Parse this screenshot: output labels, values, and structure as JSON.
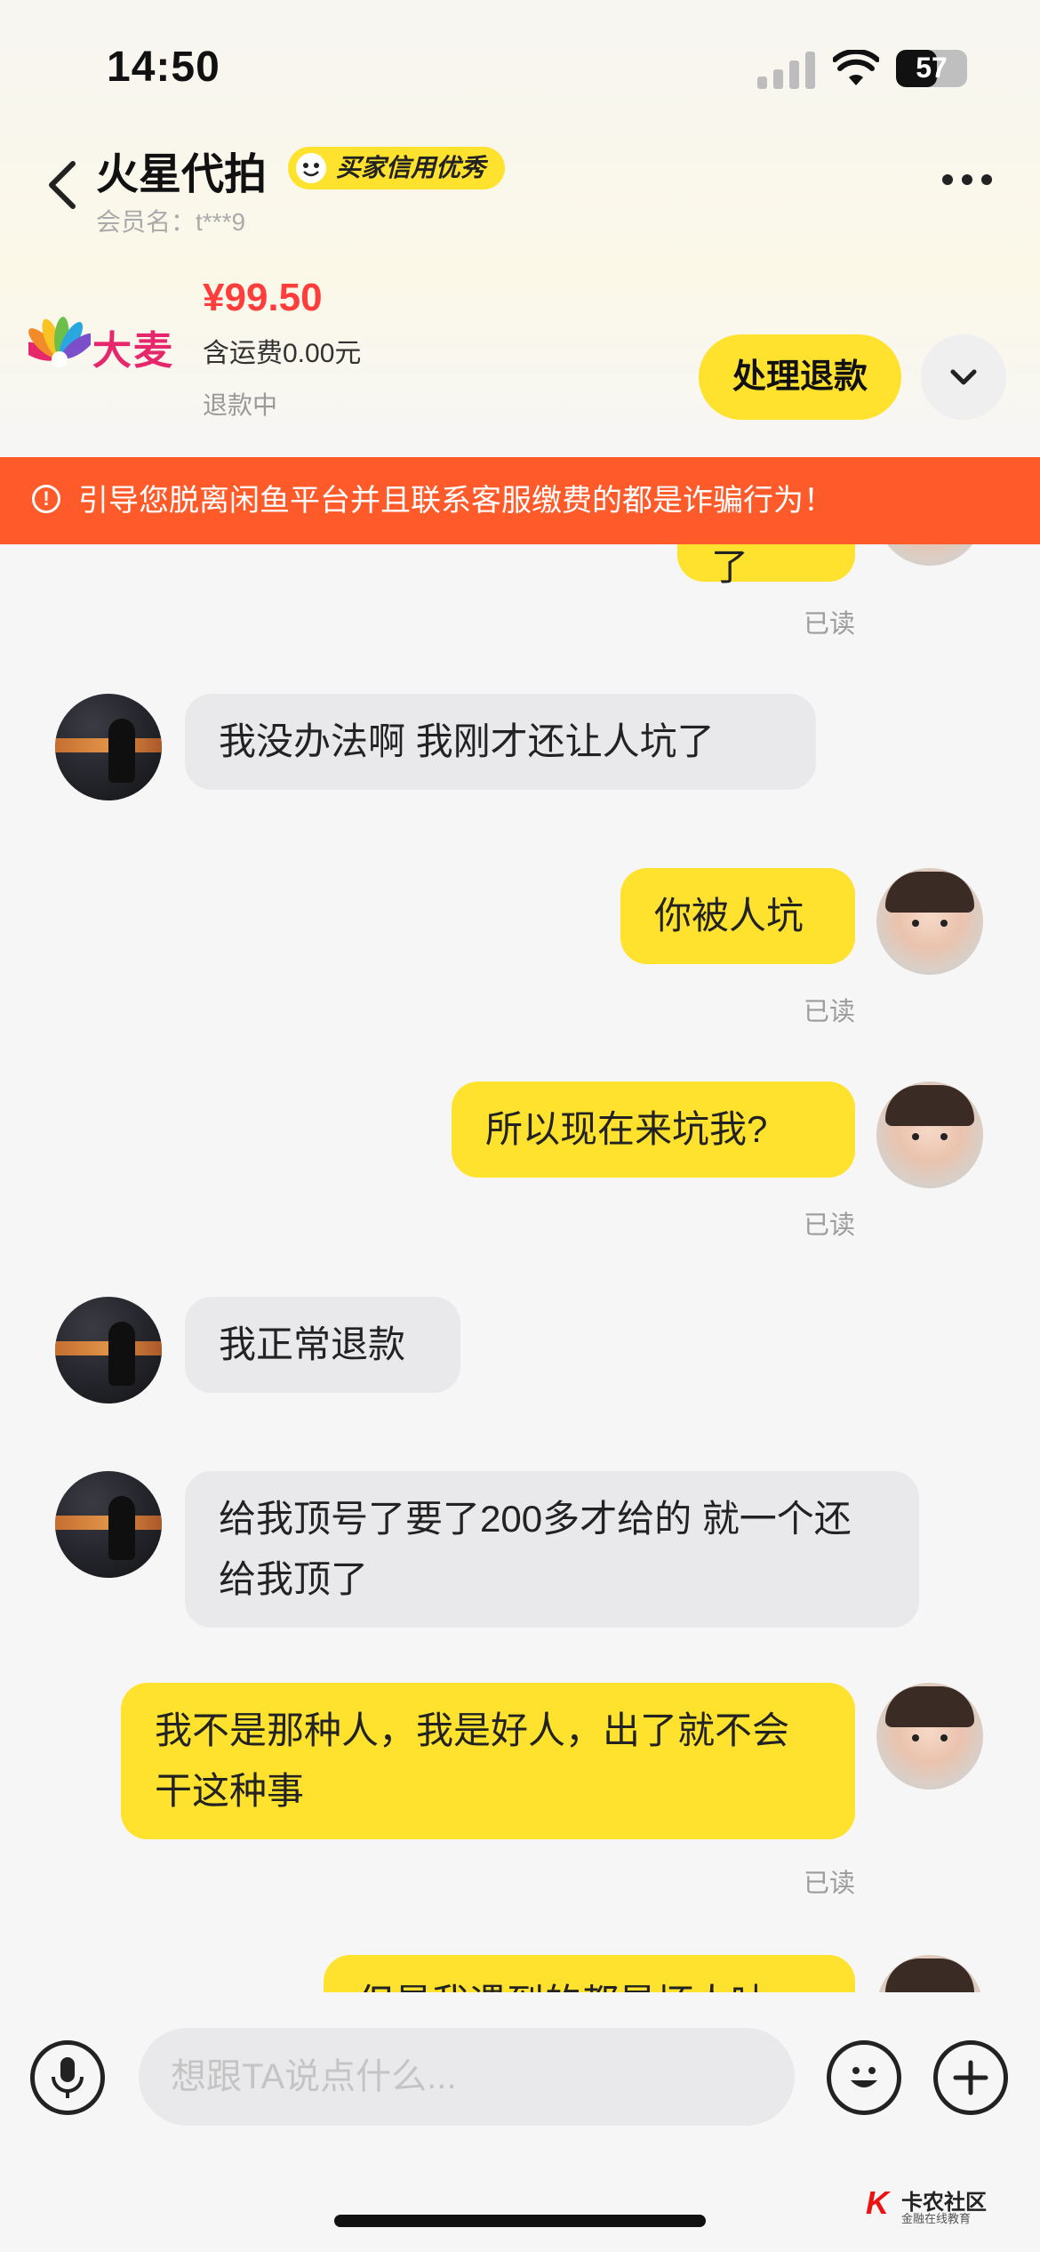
{
  "status_bar": {
    "time": "14:50",
    "battery": "57",
    "battery_level": 0.57
  },
  "header": {
    "shop_name": "火星代拍",
    "credit_badge": "买家信用优秀",
    "member_label": "会员名：t***9"
  },
  "product": {
    "logo_text": "大麦",
    "price": "¥99.50",
    "shipping": "含运费0.00元",
    "status": "退款中",
    "action_button": "处理退款"
  },
  "warning": {
    "icon": "exclamation-circle-icon",
    "text": "引导您脱离闲鱼平台并且联系客服缴费的都是诈骗行为！"
  },
  "messages": [
    {
      "from": "me",
      "text": "再见了",
      "read": "已读"
    },
    {
      "from": "other",
      "text": "我没办法啊 我刚才还让人坑了"
    },
    {
      "from": "me",
      "text": "你被人坑",
      "read": "已读"
    },
    {
      "from": "me",
      "text": "所以现在来坑我?",
      "read": "已读"
    },
    {
      "from": "other",
      "text": "我正常退款"
    },
    {
      "from": "other",
      "text": "给我顶号了要了200多才给的 就一个还给我顶了"
    },
    {
      "from": "me",
      "text": "我不是那种人，我是好人，出了就不会干这种事",
      "read": "已读"
    },
    {
      "from": "me",
      "text": "但是我遇到的都是坏人呐"
    }
  ],
  "input": {
    "placeholder": "想跟TA说点什么...",
    "voice_icon": "microphone-icon",
    "emoji_icon": "emoji-icon",
    "plus_icon": "plus-icon"
  },
  "watermark": {
    "title": "卡农社区",
    "subtitle": "金融在线教育"
  }
}
